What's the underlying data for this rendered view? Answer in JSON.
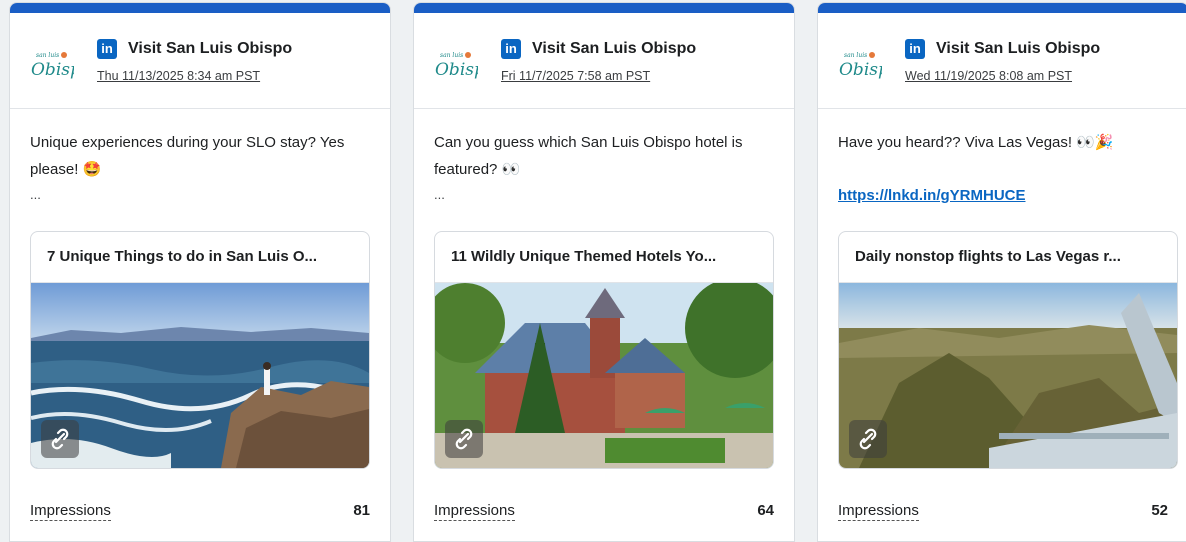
{
  "cards": [
    {
      "account": "Visit San Luis Obispo",
      "date": "Thu 11/13/2025 8:34 am PST",
      "text": "Unique experiences during your SLO stay? Yes please! 🤩",
      "ellipsis": "...",
      "preview_title": "7 Unique Things to do in San Luis O...",
      "metric_label": "Impressions",
      "metric_value": "81"
    },
    {
      "account": "Visit San Luis Obispo",
      "date": "Fri 11/7/2025 7:58 am PST",
      "text": "Can you guess which San Luis Obispo hotel is featured? 👀",
      "ellipsis": "...",
      "preview_title": "11 Wildly Unique Themed Hotels Yo...",
      "metric_label": "Impressions",
      "metric_value": "64"
    },
    {
      "account": "Visit San Luis Obispo",
      "date": "Wed 11/19/2025 8:08 am PST",
      "text": "Have you heard?? Viva Las Vegas! 👀🎉",
      "link": "https://lnkd.in/gYRMHUCE",
      "preview_title": "Daily nonstop flights to Las Vegas r...",
      "metric_label": "Impressions",
      "metric_value": "52"
    }
  ],
  "logo_text": "Obispo",
  "logo_small_text": "san luis",
  "linkedin_glyph": "in",
  "colors": {
    "topbar": "#1a5ec5",
    "linkedin": "#0a66c2",
    "logo_teal": "#1f8a8a",
    "logo_orange": "#e5793a"
  },
  "icons": [
    "linkedin-icon",
    "link-icon",
    "visit-slo-logo"
  ]
}
